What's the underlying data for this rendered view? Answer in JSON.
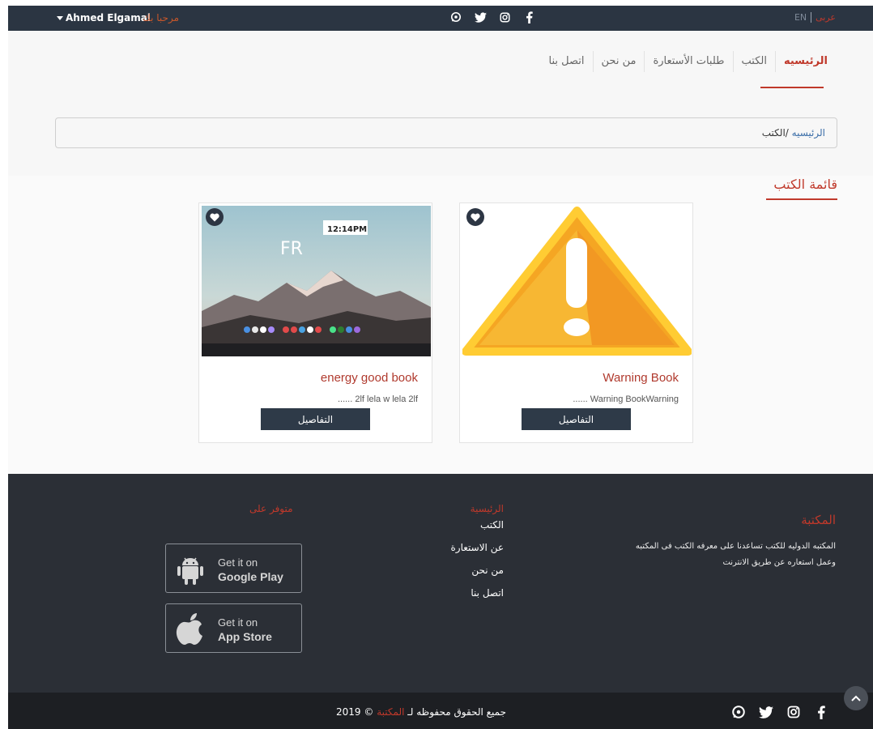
{
  "topbar": {
    "user_name": "Ahmed Elgamal",
    "welcome": "مرحبا بك",
    "lang_en": "EN",
    "lang_ar": "عربى",
    "social": [
      "whatsapp-icon",
      "twitter-icon",
      "instagram-icon",
      "facebook-icon"
    ]
  },
  "nav": {
    "items": [
      {
        "label": "الرئيسيه",
        "active": true
      },
      {
        "label": "الكتب",
        "active": false
      },
      {
        "label": "طلبات الأستعارة",
        "active": false
      },
      {
        "label": "من نحن",
        "active": false
      },
      {
        "label": "اتصل بنا",
        "active": false
      }
    ]
  },
  "breadcrumb": {
    "home": "الرئيسيه",
    "separator": " /",
    "current": "الكتب"
  },
  "section": {
    "title": "قائمة الكتب"
  },
  "books": [
    {
      "title": "Warning Book",
      "description": "...... Warning BookWarning",
      "button": "التفاصيل",
      "image": "warning-image"
    },
    {
      "title": "energy good book",
      "description": "...... 2lf lela w lela 2lf",
      "button": "التفاصيل",
      "image": "mountain-desktop-image",
      "image_clock": "12:14PM",
      "image_day": "FR"
    }
  ],
  "footer": {
    "library_title": "المكتبة",
    "library_desc": "المكتبه الدوليه للكتب تساعدنا على معرفه الكتب فى المكتبه وعمل استعاره عن طريق الانترنت",
    "links_heading": "الرئيسية",
    "links": [
      "الكتب",
      "عن الاستعارة",
      "من نحن",
      "اتصل بنا"
    ],
    "available_on": "متوفر على",
    "google_play": {
      "line1": "Get it on",
      "line2": "Google Play"
    },
    "app_store": {
      "line1": "Get it on",
      "line2": "App Store"
    },
    "copyright_prefix": "جميع الحقوق محفوظه لـ",
    "copyright_brand": "المكتبة",
    "copyright_suffix": "© 2019"
  },
  "colors": {
    "accent": "#c0392b",
    "dark": "#2b3542",
    "footer": "#2b2f36"
  }
}
